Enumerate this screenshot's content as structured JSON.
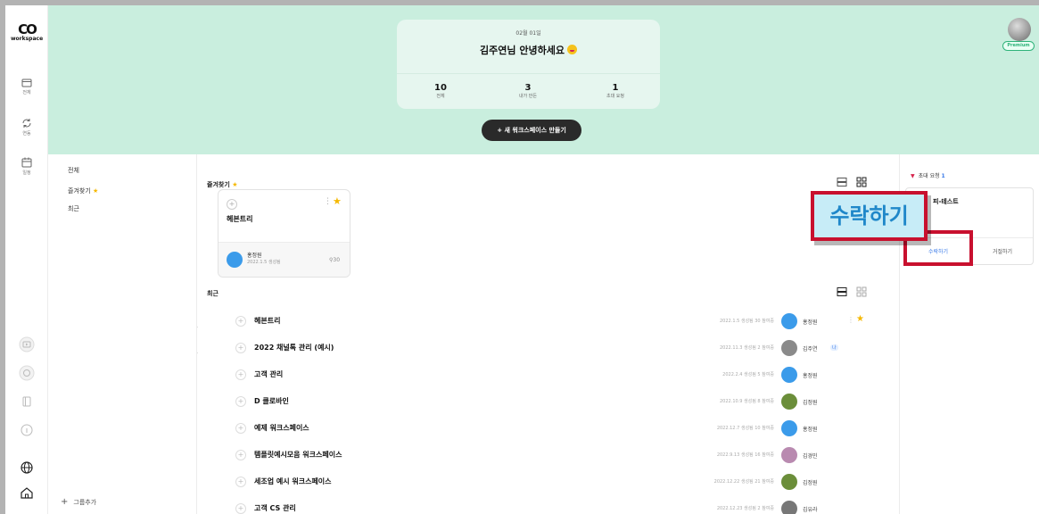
{
  "app": {
    "logo_mark": "CO",
    "logo_word": "workspace"
  },
  "rail": {
    "items": [
      {
        "label": "전체",
        "icon": "folder-icon"
      },
      {
        "label": "연동",
        "icon": "sync-icon"
      },
      {
        "label": "일정",
        "icon": "calendar-icon"
      }
    ]
  },
  "hero": {
    "date": "02월 01일",
    "greeting": "김주연님 안녕하세요",
    "stats": [
      {
        "value": "10",
        "label": "전체"
      },
      {
        "value": "3",
        "label": "내가 만든"
      },
      {
        "value": "1",
        "label": "초대 요청"
      }
    ],
    "create_button": "+ 새 워크스페이스 만들기",
    "badge": "Premium"
  },
  "groups": {
    "items": [
      "전체",
      "즐겨찾기",
      "최근"
    ],
    "add_label": "그룹추가"
  },
  "favorites": {
    "title": "즐겨찾기",
    "card": {
      "name": "헤븐트리",
      "owner": "홍정원",
      "created": "2022.1.5 생성됨",
      "members": "30"
    }
  },
  "recent": {
    "title": "최근",
    "rows": [
      {
        "title": "헤븐트리",
        "meta": "2022.1.5 생성됨   30 참여중",
        "owner": "홍정원",
        "avatar": "#3b9bea",
        "starred": true,
        "me": false
      },
      {
        "title": "2022 채널톡 관리 (예시)",
        "meta": "2022.11.3 생성됨   2 참여중",
        "owner": "김주연",
        "avatar": "#8a8a8a",
        "starred": false,
        "me": true
      },
      {
        "title": "고객 관리",
        "meta": "2022.2.4 생성됨   5 참여중",
        "owner": "홍정원",
        "avatar": "#3b9bea",
        "starred": false,
        "me": false
      },
      {
        "title": "D 클로바인",
        "meta": "2022.10.9 생성됨   8 참여중",
        "owner": "김정원",
        "avatar": "#6b8e3a",
        "starred": false,
        "me": false
      },
      {
        "title": "예제 워크스페이스",
        "meta": "2022.12.7 생성됨   10 참여중",
        "owner": "홍정원",
        "avatar": "#3b9bea",
        "starred": false,
        "me": false
      },
      {
        "title": "템플릿예시모음 워크스페이스",
        "meta": "2022.9.13 생성됨   16 참여중",
        "owner": "김경민",
        "avatar": "#b98ab0",
        "starred": false,
        "me": false
      },
      {
        "title": "세조업 예시 워크스페이스",
        "meta": "2022.12.22 생성됨   21 참여중",
        "owner": "김정원",
        "avatar": "#6b8e3a",
        "starred": false,
        "me": false
      },
      {
        "title": "고객 CS 관리",
        "meta": "2022.12.23 생성됨   2 참여중",
        "owner": "김유라",
        "avatar": "#777777",
        "starred": false,
        "me": false
      }
    ],
    "me_label": "나"
  },
  "invites": {
    "title": "초대 요청",
    "count": "1",
    "item_name": "피-테스트",
    "accept": "수락하기",
    "reject": "거절하기"
  },
  "callout": {
    "text": "수락하기"
  }
}
